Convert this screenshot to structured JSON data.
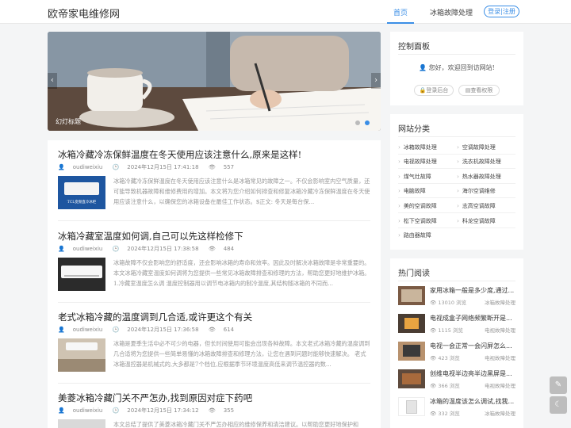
{
  "header": {
    "logo": "欧帝家电维修网",
    "nav": [
      {
        "label": "首页",
        "active": true
      },
      {
        "label": "冰箱故障处理",
        "active": false
      }
    ],
    "login": "登录|注册"
  },
  "carousel": {
    "caption": "幻灯标题",
    "prev": "‹",
    "next": "›"
  },
  "posts": [
    {
      "title": "冰箱冷藏冷冻保鲜温度在冬天使用应该注意什么,原来是这样!",
      "author": "oudiweixiu",
      "date": "2024年12月15日 17:41:18",
      "views": "557",
      "thumb_text": "TCL变频直冷冰柜",
      "excerpt": "冰箱冷藏冷冻保鲜温度在冬天使用应该注意什么是冰箱常见的故障之一。不仅会影响室内空气质量，还可能导致机器故障和维修费用的增加。本文将为您介绍如何排查和修复冰箱冷藏冷冻保鲜温度在冬天使用应该注意什么，以确保您的冰箱设备在最佳工作状态。$正文: 冬天是每台保..."
    },
    {
      "title": "冰箱冷藏室温度如何调,自己可以先这样检修下",
      "author": "oudiweixiu",
      "date": "2024年12月15日 17:38:58",
      "views": "484",
      "excerpt": "冰箱故障不仅会影响您的舒适度，还会影响冰箱的寿命和效率。因此及时解决冰箱故障是非常重要的。本文冰箱冷藏室温度如何调将为您提供一些常见冰箱故障排查和修理的方法，帮助您更好地维护冰箱。 1.冷藏室温度怎么调 温度控制器用以调节电冰箱内的制冷温度,其结构随冰箱的不同而..."
    },
    {
      "title": "老式冰箱冷藏的温度调到几合适,或许更这个有关",
      "author": "oudiweixiu",
      "date": "2024年12月15日 17:36:58",
      "views": "614",
      "excerpt": "冰箱是夏季生活中必不可少的电器，但长时间使用可能会出现各种故障。本文老式冰箱冷藏的温度调到几合适将为您提供一些简单易懂的冰箱故障排查和修理方法，让您在遇到问题时能够快速解决。 老式冰箱温控器是机械式的,大多都是7个档位,应根据季节环境温度高低来调节温控器的数..."
    },
    {
      "title": "美菱冰箱冷藏门关不严怎办,找到原因对症下药吧",
      "author": "oudiweixiu",
      "date": "2024年12月15日 17:34:12",
      "views": "355",
      "excerpt": "本文总结了提供了美菱冰箱冷藏门关不严怎办相应的维修保养和清洁建议。以帮助您更好地保护和"
    }
  ],
  "panel": {
    "title": "控制面板",
    "welcome": "您好，欢迎回到访网站!",
    "buttons": [
      "登录后台",
      "查看权限"
    ]
  },
  "categories": {
    "title": "网站分类",
    "items": [
      "冰箱故障处理",
      "空调故障处理",
      "电视故障处理",
      "洗衣机故障处理",
      "煤气灶故障",
      "热水器故障处理",
      "电脑故障",
      "海尔空调维修",
      "美的空调故障",
      "志高空调故障",
      "松下空调故障",
      "科龙空调故障",
      "路由器故障"
    ]
  },
  "hot": {
    "title": "热门阅读",
    "items": [
      {
        "title": "家用冰箱一般是多少度,通过...",
        "views": "13010 浏览",
        "cat": "冰箱故障处理"
      },
      {
        "title": "电视成盒子网络频繁断开是...",
        "views": "1115 浏览",
        "cat": "电视故障处理"
      },
      {
        "title": "电视一会正常一会闪屏怎么...",
        "views": "423 浏览",
        "cat": "电视故障处理"
      },
      {
        "title": "创维电视半边亮半边黑屏是...",
        "views": "366 浏览",
        "cat": "电视故障处理"
      },
      {
        "title": "冰箱的温度该怎么调试,找我...",
        "views": "332 浏览",
        "cat": "冰箱故障处理"
      }
    ]
  },
  "colors": {
    "accent": "#3a8ee6",
    "background": "#f4f5f6"
  },
  "icons": {
    "user": "user-icon",
    "clock": "clock-icon",
    "eye": "eye-icon",
    "lock": "lock-icon",
    "float_top": "chat-icon",
    "float_bottom": "moon-icon"
  }
}
